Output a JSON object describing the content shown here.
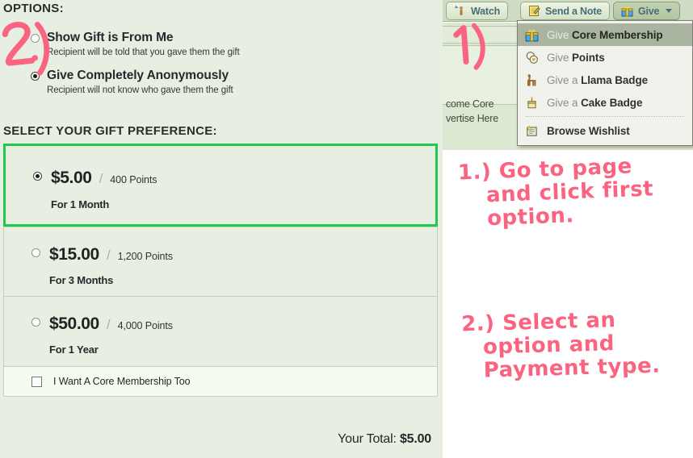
{
  "left_panel": {
    "options_heading": "OPTIONS:",
    "options": [
      {
        "title": "Show Gift is From Me",
        "subtitle": "Recipient will be told that you gave them the gift",
        "selected": false
      },
      {
        "title": "Give Completely Anonymously",
        "subtitle": "Recipient will not know who gave them the gift",
        "selected": true
      }
    ],
    "preference_heading": "SELECT YOUR GIFT PREFERENCE:",
    "preferences": [
      {
        "price": "$5.00",
        "separator": "/",
        "points": "400 Points",
        "duration": "For 1 Month",
        "selected": true
      },
      {
        "price": "$15.00",
        "separator": "/",
        "points": "1,200 Points",
        "duration": "For 3 Months",
        "selected": false
      },
      {
        "price": "$50.00",
        "separator": "/",
        "points": "4,000 Points",
        "duration": "For 1 Year",
        "selected": false
      }
    ],
    "extra_option": {
      "label": "I Want A Core Membership Too",
      "checked": false
    },
    "total": {
      "label": "Your Total: ",
      "amount": "$5.00"
    },
    "highlight_color": "#1fc94a",
    "background_color": "#e7eee2"
  },
  "toolbar": {
    "watch_label": "Watch",
    "note_label": "Send a Note",
    "give_label": "Give",
    "watch_icon": "watch-person-icon",
    "note_icon": "note-pencil-icon",
    "give_icon": "gift-box-icon",
    "caret_icon": "chevron-down-icon"
  },
  "page_behind": {
    "line1": "come Core",
    "line2": "vertise Here"
  },
  "menu": {
    "items": [
      {
        "prefix": "Give ",
        "emphasis": "Core Membership",
        "icon": "gift-box-icon",
        "active": true
      },
      {
        "prefix": "Give ",
        "emphasis": "Points",
        "icon": "points-coins-icon",
        "active": false
      },
      {
        "prefix": "Give a ",
        "emphasis": "Llama Badge",
        "icon": "llama-icon",
        "active": false
      },
      {
        "prefix": "Give a ",
        "emphasis": "Cake Badge",
        "icon": "cake-icon",
        "active": false
      },
      {
        "prefix": "",
        "emphasis": "Browse Wishlist",
        "icon": "wishlist-icon",
        "active": false,
        "after_separator": true
      }
    ],
    "highlight_background": "#a9b5a1"
  },
  "annotations": {
    "ink_color": "#fb6480",
    "marker_left": "2.)",
    "marker_right": "1.)",
    "note_1_line1": "1.) Go to page",
    "note_1_line2": "and click first",
    "note_1_line3": "option.",
    "note_2_line1": "2.) Select an",
    "note_2_line2": "option and",
    "note_2_line3": "Payment type.",
    "arrow_icon": "arrow-up-right-icon"
  }
}
